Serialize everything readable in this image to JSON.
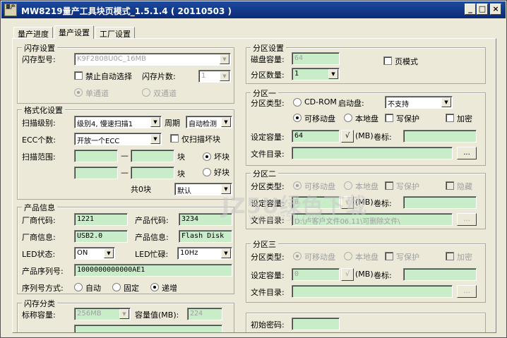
{
  "window": {
    "title": "MW8219量产工具块页模式_1.5.1.4 ( 20110503 )",
    "icon_text": "量产"
  },
  "tabs": [
    {
      "label": "量产进度"
    },
    {
      "label": "量产设置"
    },
    {
      "label": "工厂设置"
    }
  ],
  "flash": {
    "legend": "闪存设置",
    "model_label": "闪存型号:",
    "model_value": "K9F2808U0C_16MB",
    "disable_auto_label": "禁止自动选择",
    "count_label": "闪存片数:",
    "count_value": "1",
    "single_label": "单通道",
    "dual_label": "双通道"
  },
  "format": {
    "legend": "格式化设置",
    "scan_label": "扫描级别:",
    "scan_value": "级别4, 慢速扫描1",
    "cycle_label": "周期",
    "cycle_value": "自动检测",
    "ecc_label": "ECC个数:",
    "ecc_value": "开放一个ECC",
    "scan_bad_label": "仅扫描坏块",
    "range_label": "扫描范围:",
    "dash1": "—",
    "dash2": "—",
    "block1": "块",
    "block2": "块",
    "bad_label": "坏块",
    "good_label": "好块",
    "total_label": "共0块",
    "default_value": "默认"
  },
  "product": {
    "legend": "产品信息",
    "vendor_code_label": "厂商代码:",
    "vendor_code_value": "1221",
    "product_code_label": "产品代码:",
    "product_code_value": "3234",
    "vendor_info_label": "厂商信息:",
    "vendor_info_value": "USB2.0",
    "product_info_label": "产品信息:",
    "product_info_value": "Flash Disk",
    "led_state_label": "LED状态:",
    "led_state_value": "ON",
    "led_busy_label": "LED忙碌:",
    "led_busy_value": "10Hz",
    "serial_label": "产品序列号:",
    "serial_value": "1000000000000AE1",
    "serial_mode_label": "序列号方式:",
    "mode_auto": "自动",
    "mode_fixed": "固定",
    "mode_inc": "递增"
  },
  "flash_class": {
    "legend": "闪存分类",
    "nominal_label": "标称容量:",
    "nominal_value": "256MB",
    "cap_label": "容量值(MB):",
    "cap_value": "224"
  },
  "partition": {
    "legend": "分区设置",
    "disk_cap_label": "磁盘容量:",
    "disk_cap_value": "64",
    "page_mode_label": "页模式",
    "count_label": "分区数量:",
    "count_value": "1"
  },
  "part1": {
    "legend": "分区一",
    "type_label": "分区类型:",
    "cdrom_label": "CD-ROM",
    "boot_label": "启动盘:",
    "boot_value": "不支持",
    "removable_label": "可移动盘",
    "local_label": "本地盘",
    "wp_label": "写保护",
    "encrypt_label": "加密",
    "cap_label": "设定容量:",
    "cap_value": "64",
    "mb_label": "(MB)",
    "vol_label": "卷标:",
    "dir_label": "文件目录:",
    "browse": "...",
    "check": "√"
  },
  "part2": {
    "legend": "分区二",
    "type_label": "分区类型:",
    "removable_label": "可移动盘",
    "local_label": "本地盘",
    "wp_label": "写保护",
    "hidden_label": "隐藏",
    "cap_label": "设定容量:",
    "cap_value": "0",
    "mb_label": "(MB)",
    "vol_label": "卷标:",
    "dir_label": "文件目录:",
    "dir_value": "D:\\卢客户文件06.11\\可删除文件\\",
    "browse": "...",
    "check": "√"
  },
  "part3": {
    "legend": "分区三",
    "type_label": "分区类型:",
    "removable_label": "可移动盘",
    "local_label": "本地盘",
    "wp_label": "写保护",
    "encrypt_label": "加密",
    "cap_label": "设定容量:",
    "cap_value": "0",
    "mb_label": "(MB)",
    "vol_label": "卷标:",
    "dir_label": "文件目录:",
    "browse": "...",
    "check": "√"
  },
  "init_password_label": "初始密码:",
  "watermark": {
    "main": "JZ5U绿色下载",
    "sub": "www.jz5u.com"
  }
}
